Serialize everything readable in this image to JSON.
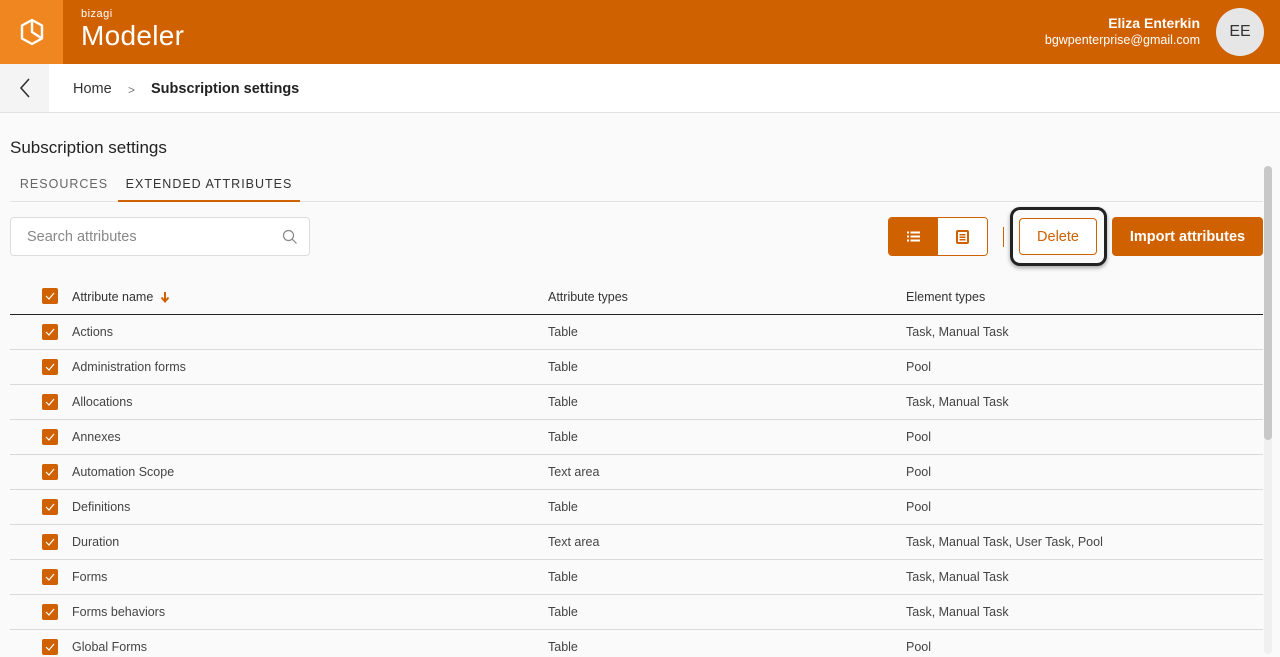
{
  "header": {
    "brand_small": "bizagi",
    "brand_big": "Modeler",
    "logo_icon": "cube-icon",
    "user_name": "Eliza Enterkin",
    "user_email": "bgwpenterprise@gmail.com",
    "avatar_initials": "EE"
  },
  "breadcrumb": {
    "back_icon": "chevron-left-icon",
    "home": "Home",
    "separator": ">",
    "current": "Subscription settings"
  },
  "page": {
    "title": "Subscription settings",
    "tabs": [
      {
        "label": "Resources",
        "active": false
      },
      {
        "label": "Extended attributes",
        "active": true
      }
    ]
  },
  "toolbar": {
    "search_placeholder": "Search attributes",
    "search_value": "",
    "list_view_icon": "list-icon",
    "detail_view_icon": "document-list-icon",
    "delete_label": "Delete",
    "import_label": "Import attributes"
  },
  "table": {
    "headers": {
      "name": "Attribute name",
      "name_sort": "descending-arrow-icon",
      "types": "Attribute types",
      "elements": "Element types"
    },
    "select_all_checked": true,
    "rows": [
      {
        "name": "Actions",
        "type": "Table",
        "elements": "Task,  Manual Task",
        "checked": true
      },
      {
        "name": "Administration forms",
        "type": "Table",
        "elements": "Pool",
        "checked": true
      },
      {
        "name": "Allocations",
        "type": "Table",
        "elements": "Task,  Manual Task",
        "checked": true
      },
      {
        "name": "Annexes",
        "type": "Table",
        "elements": "Pool",
        "checked": true
      },
      {
        "name": "Automation Scope",
        "type": "Text area",
        "elements": "Pool",
        "checked": true
      },
      {
        "name": "Definitions",
        "type": "Table",
        "elements": "Pool",
        "checked": true
      },
      {
        "name": "Duration",
        "type": "Text area",
        "elements": "Task,  Manual Task,  User Task,  Pool",
        "checked": true
      },
      {
        "name": "Forms",
        "type": "Table",
        "elements": "Task,  Manual Task",
        "checked": true
      },
      {
        "name": "Forms behaviors",
        "type": "Table",
        "elements": "Task,  Manual Task",
        "checked": true
      },
      {
        "name": "Global Forms",
        "type": "Table",
        "elements": "Pool",
        "checked": true
      }
    ]
  },
  "colors": {
    "brand_primary": "#cf6100",
    "brand_logo_bg": "#f0861f",
    "avatar_bg": "#e6e6e6"
  }
}
